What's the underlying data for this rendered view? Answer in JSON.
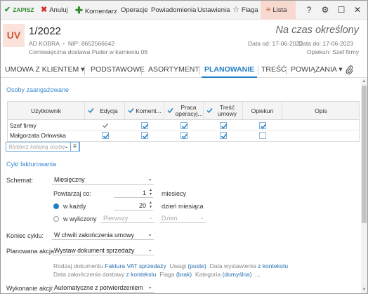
{
  "toolbar": {
    "save_label": "ZAPISZ",
    "cancel_label": "Anuluj",
    "comment_label": "Komentarz",
    "operations_label": "Operacje",
    "notifications_label": "Powiadomienia",
    "settings_label": "Ustawienia",
    "flag_label": "Flaga",
    "list_label": "Lista",
    "help_glyph": "?",
    "settings_glyph": "⚙",
    "maximize_glyph": "☐",
    "close_glyph": "✕"
  },
  "header": {
    "badge": "UV",
    "number": "1/2022",
    "company": "AD KOBRA",
    "nip": "NIP: 8652566642",
    "description": "Comiesięczna dostawa Puder w kamieniu 06",
    "status": "Na czas określony",
    "date_from": "Data od: 17-06-2022",
    "date_to": "Data do: 17-06-2023",
    "guardian": "Opiekun: Szef firmy"
  },
  "tabs": [
    {
      "label": "UMOWA Z KLIENTEM ▾"
    },
    {
      "label": "PODSTAWOWE"
    },
    {
      "label": "ASORTYMENT"
    },
    {
      "label": "PLANOWANIE"
    },
    {
      "label": "TREŚĆ"
    },
    {
      "label": "POWIĄZANIA ▾"
    }
  ],
  "people": {
    "title": "Osoby zaangażowane",
    "columns": {
      "user": "Użytkownik",
      "edit": "Edycja",
      "comments": "Koment...",
      "operations": "Praca operacyj...",
      "content": "Treść umowy",
      "guardian": "Opiekun",
      "description": "Opis"
    },
    "rows": [
      {
        "name": "Szef firmy"
      },
      {
        "name": "Małgorzata Orłowska"
      }
    ],
    "select_placeholder": "Wybierz kolejną osobę"
  },
  "billing": {
    "title": "Cykl fakturowania",
    "schedule_label": "Schemat:",
    "schedule_value": "Miesięczny",
    "repeat_label": "Powtarzaj co:",
    "repeat_value": "1",
    "repeat_unit": "miesiecy",
    "every_label": "w każdy",
    "every_value": "20",
    "every_unit": "dzień miesiąca",
    "listed_label": "w wyliczony",
    "listed_first": "Pierwszy",
    "listed_day": "Dzień",
    "end_label": "Koniec cyklu:",
    "end_value": "W chwili zakończenia umowy",
    "action_label": "Planowana akcja:",
    "action_value": "Wystaw dokument sprzedaży",
    "info1_a": "Rodzaj dokumentu",
    "info1_b": "Faktura VAT sprzedaży",
    "info1_c": "Uwagi",
    "info1_d": "(puste)",
    "info1_e": "Data wystawienia",
    "info1_f": "z kontekstu",
    "info2_a": "Data zakończenia dostawy",
    "info2_b": "z kontekstu",
    "info2_c": "Flaga",
    "info2_d": "(brak)",
    "info2_e": "Kategoria",
    "info2_f": "(domyślna)",
    "info2_more": "...",
    "exec_label": "Wykonanie akcji:",
    "exec_value": "Automatyczne z potwierdzeniem"
  },
  "colors": {
    "accent": "#1f7fc4",
    "save": "#2e8b2e",
    "cancel": "#d03030",
    "badge_bg": "#fbe3dc",
    "badge_fg": "#d05a3a",
    "list_bg": "#f8d9cf"
  }
}
